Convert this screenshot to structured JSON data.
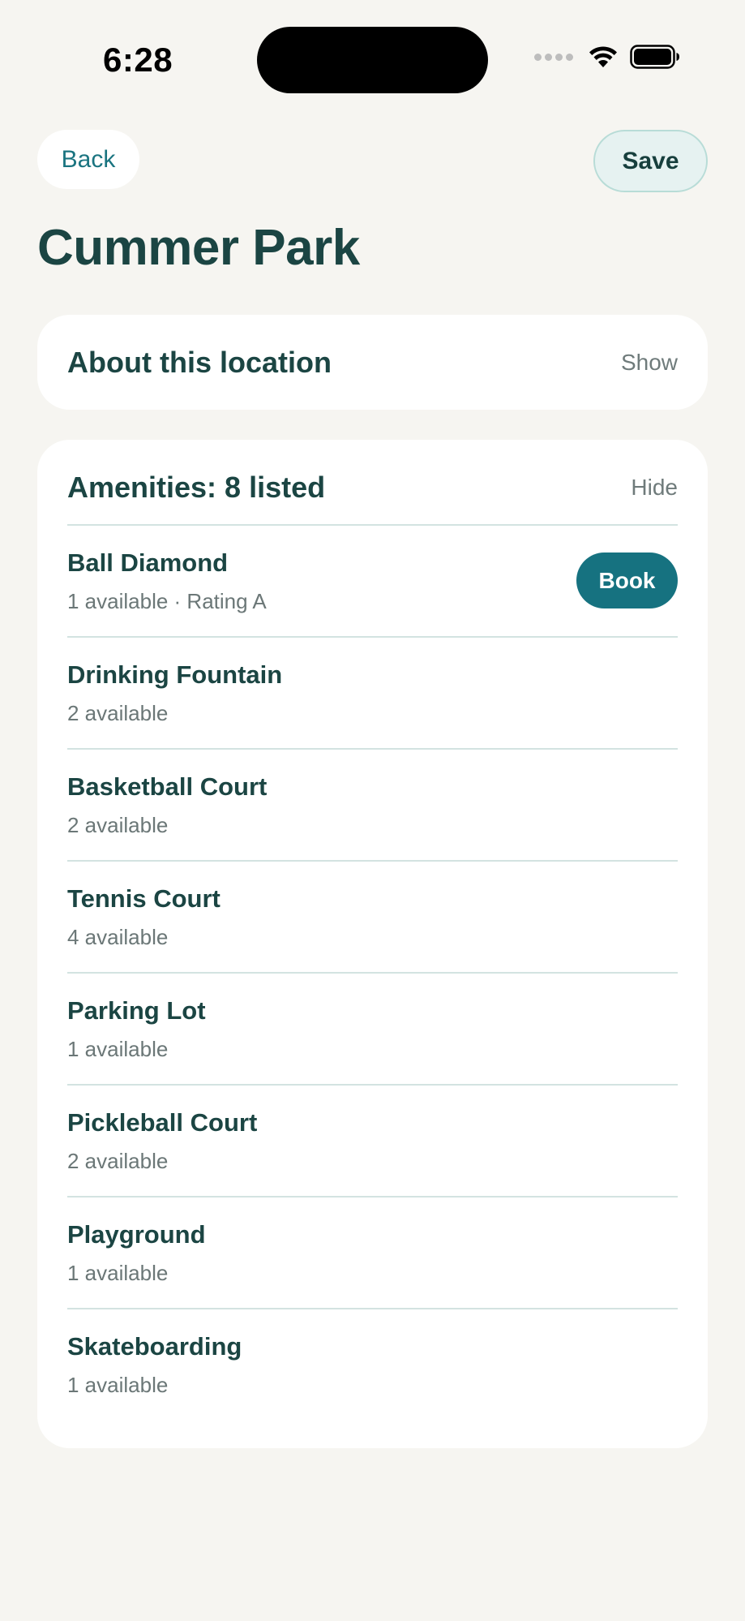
{
  "status_bar": {
    "time": "6:28",
    "icons": [
      "cellular-signal-icon",
      "wifi-icon",
      "battery-icon"
    ]
  },
  "header": {
    "back_label": "Back",
    "save_label": "Save",
    "title": "Cummer Park"
  },
  "about": {
    "title": "About this location",
    "toggle": "Show"
  },
  "amenities": {
    "title": "Amenities: 8 listed",
    "toggle": "Hide",
    "book_label": "Book",
    "items": [
      {
        "name": "Ball Diamond",
        "detail": "1 available · Rating A"
      },
      {
        "name": "Drinking Fountain",
        "detail": "2 available"
      },
      {
        "name": "Basketball Court",
        "detail": "2 available"
      },
      {
        "name": "Tennis Court",
        "detail": "4 available"
      },
      {
        "name": "Parking Lot",
        "detail": "1 available"
      },
      {
        "name": "Pickleball Court",
        "detail": "2 available"
      },
      {
        "name": "Playground",
        "detail": "1 available"
      },
      {
        "name": "Skateboarding",
        "detail": "1 available"
      }
    ]
  },
  "colors": {
    "background": "#f6f5f1",
    "text_primary": "#1b4543",
    "accent": "#167280",
    "muted": "#6b7777"
  }
}
